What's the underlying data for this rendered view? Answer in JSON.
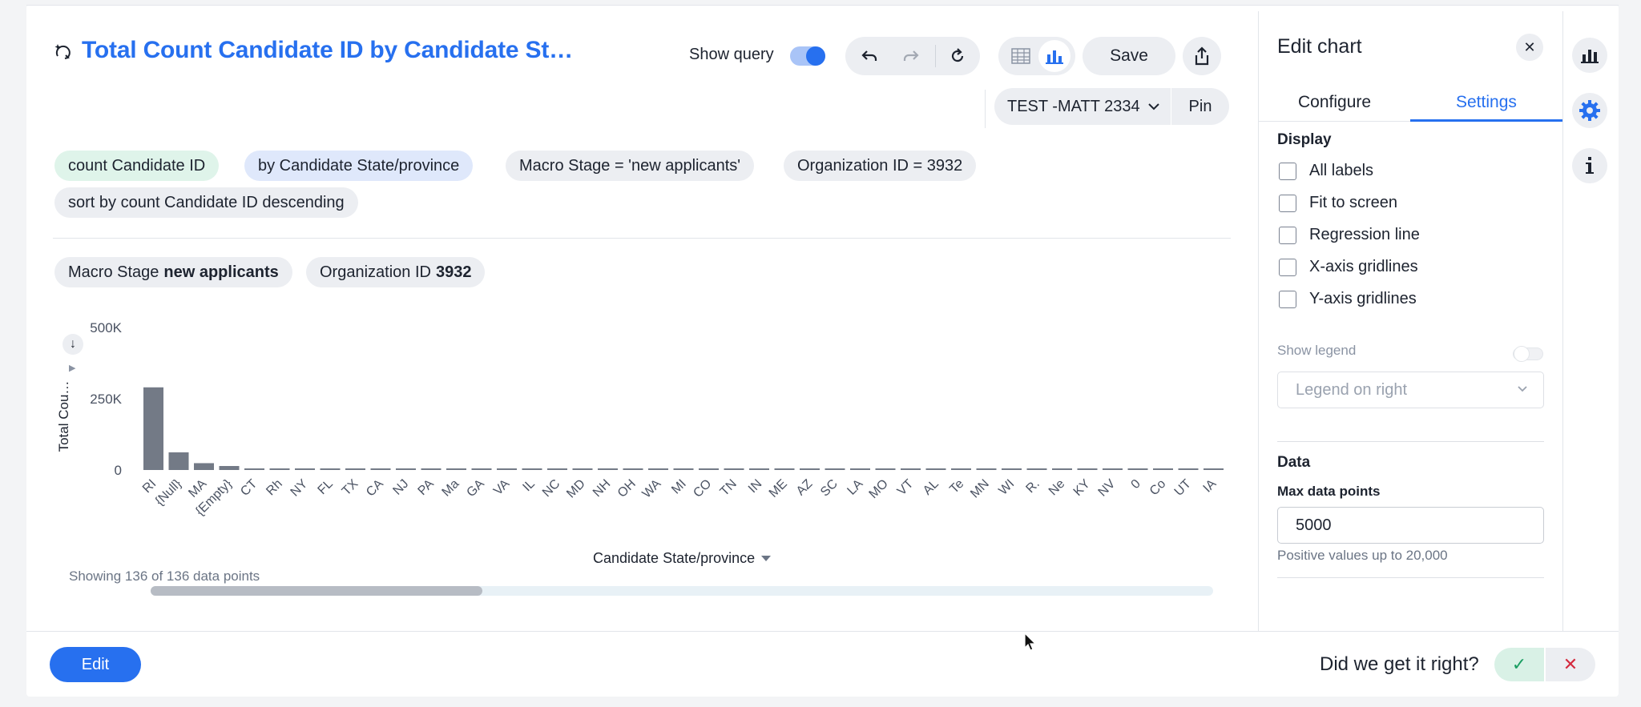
{
  "header": {
    "title": "Total Count Candidate ID by Candidate St…",
    "show_query_label": "Show query",
    "show_query_on": true,
    "save_label": "Save",
    "worksheet": "TEST -MATT 2334",
    "pin_label": "Pin"
  },
  "chips": {
    "measure": "count Candidate ID",
    "attribute": "by Candidate State/province",
    "filter_stage": "Macro Stage = 'new applicants'",
    "filter_org": "Organization ID = 3932",
    "sort": "sort by count Candidate ID descending"
  },
  "filters": {
    "stage_label": "Macro Stage",
    "stage_value": "new applicants",
    "org_label": "Organization ID",
    "org_value": "3932"
  },
  "chart": {
    "y_title": "Total Cou…",
    "x_title": "Candidate State/province",
    "showing": "Showing 136 of 136 data points"
  },
  "chart_data": {
    "type": "bar",
    "ylabel": "Total Cou…",
    "xlabel": "Candidate State/province",
    "ylim": [
      0,
      500000
    ],
    "y_ticks": [
      "500K",
      "250K",
      "0"
    ],
    "y_tick_values": [
      500000,
      250000,
      0
    ],
    "color": "#737a86",
    "categories": [
      "RI",
      "{Null}",
      "MA",
      "{Empty}",
      "CT",
      "Rh",
      "NY",
      "FL",
      "TX",
      "CA",
      "NJ",
      "PA",
      "Ma",
      "GA",
      "VA",
      "IL",
      "NC",
      "MD",
      "NH",
      "OH",
      "WA",
      "MI",
      "CO",
      "TN",
      "IN",
      "ME",
      "AZ",
      "SC",
      "LA",
      "MO",
      "VT",
      "AL",
      "Te",
      "MN",
      "WI",
      "R.",
      "Ne",
      "KY",
      "NV",
      "0",
      "Co",
      "UT",
      "IA"
    ],
    "values": [
      290000,
      62000,
      24000,
      14000,
      4000,
      3000,
      3000,
      3000,
      3000,
      3000,
      3000,
      3000,
      3000,
      3000,
      3000,
      3000,
      3000,
      3000,
      3000,
      3000,
      3000,
      3000,
      3000,
      3000,
      3000,
      3000,
      3000,
      3000,
      3000,
      3000,
      3000,
      3000,
      3000,
      3000,
      3000,
      3000,
      3000,
      3000,
      3000,
      3000,
      3000,
      3000,
      3000
    ]
  },
  "panel": {
    "title": "Edit chart",
    "tab_configure": "Configure",
    "tab_settings": "Settings",
    "display_heading": "Display",
    "options": [
      "All labels",
      "Fit to screen",
      "Regression line",
      "X-axis gridlines",
      "Y-axis gridlines"
    ],
    "show_legend_label": "Show legend",
    "legend_position": "Legend on right",
    "data_heading": "Data",
    "max_points_label": "Max data points",
    "max_points_value": "5000",
    "max_points_hint": "Positive values up to 20,000"
  },
  "footer": {
    "edit_label": "Edit",
    "feedback_question": "Did we get it right?"
  },
  "colors": {
    "accent": "#2770ef",
    "bar": "#737a86",
    "positive": "#1a9e62",
    "negative": "#d42a3e"
  },
  "icons": {
    "title": "sparkle-query-icon",
    "undo": "undo-icon",
    "redo": "redo-icon",
    "reset": "reset-icon",
    "table_view": "table-icon",
    "chart_view": "bar-chart-icon",
    "share": "share-icon",
    "close": "close-icon",
    "rail": [
      "bar-chart-icon",
      "gear-icon",
      "info-icon"
    ]
  }
}
